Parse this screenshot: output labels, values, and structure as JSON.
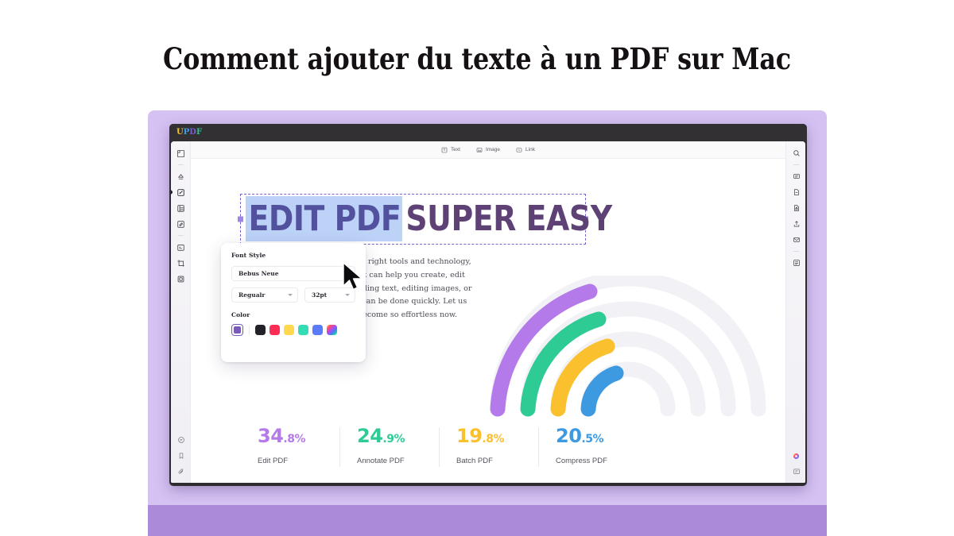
{
  "page": {
    "title": "Comment ajouter du texte à un PDF sur Mac",
    "background_top_color": "#e888fd",
    "background_bottom_color": "#fffdff",
    "frame_color": "#d5c2f3",
    "bottom_bar_color": "#ab8ad9"
  },
  "app": {
    "logo": {
      "name": "UPDF",
      "letters": [
        "U",
        "P",
        "D",
        "F"
      ]
    },
    "toolbar": {
      "items": [
        {
          "id": "text",
          "label": "Text",
          "icon": "text-box-icon"
        },
        {
          "id": "image",
          "label": "Image",
          "icon": "image-icon"
        },
        {
          "id": "link",
          "label": "Link",
          "icon": "link-box-icon"
        }
      ],
      "search_icon": "search-icon"
    },
    "left_rail": {
      "top_icons": [
        "page-thumbnail-icon",
        "reader-mode-icon",
        "edit-pdf-icon",
        "organize-pages-icon",
        "annotate-icon",
        "form-icon",
        "crop-icon",
        "copy-page-icon"
      ],
      "active_icon": "edit-pdf-icon",
      "bottom_icons": [
        "comment-icon",
        "bookmark-icon",
        "attachment-icon"
      ]
    },
    "right_rail": {
      "top_icon": "search-icon",
      "icons": [
        "ocr-icon",
        "convert-pdf-icon",
        "protect-icon",
        "share-icon",
        "mail-icon",
        "properties-icon"
      ],
      "bottom_icons": [
        "ai-assistant-icon",
        "feedback-icon"
      ]
    }
  },
  "document": {
    "headline": {
      "selected_text": "EDIT PDF",
      "rest_text": "SUPER EASY",
      "selection_highlight_color": "#bcd2f7",
      "selected_text_color": "#51519e",
      "rest_text_color": "#5e4276",
      "selection_border_color": "#7b63c9"
    },
    "body_paragraph": "Editing PDFs is simple. With the right tools and technology, there are many applications that can help you create, edit and manage PDF files. From adding text, editing images, or signing documents, everything can be done quickly. Let us explore why editing PDFs has become so effortless now.",
    "stats": [
      {
        "value": "34",
        "decimal": ".8%",
        "label": "Edit PDF",
        "color": "#b57aea"
      },
      {
        "value": "24",
        "decimal": ".9%",
        "label": "Annotate PDF",
        "color": "#2ecc94"
      },
      {
        "value": "19",
        "decimal": ".8%",
        "label": "Batch PDF",
        "color": "#fbc02d"
      },
      {
        "value": "20",
        "decimal": ".5%",
        "label": "Compress PDF",
        "color": "#3d9ae0"
      }
    ],
    "rainbow": {
      "arc_colors": [
        "#b57aea",
        "#2ecc94",
        "#fbc02d",
        "#3d9ae0"
      ],
      "ghost_arc_color": "#f2f1f5"
    }
  },
  "font_panel": {
    "title": "Font Style",
    "font_name_value": "Bebus Neue",
    "weight_value": "Regualr",
    "size_value": "32pt",
    "color_title": "Color",
    "selected_color": "#7a5bbd",
    "swatches": [
      "#232228",
      "#ff2d55",
      "#ffd84d",
      "#35dbb5",
      "#5b7cfa",
      "rainbow"
    ]
  }
}
